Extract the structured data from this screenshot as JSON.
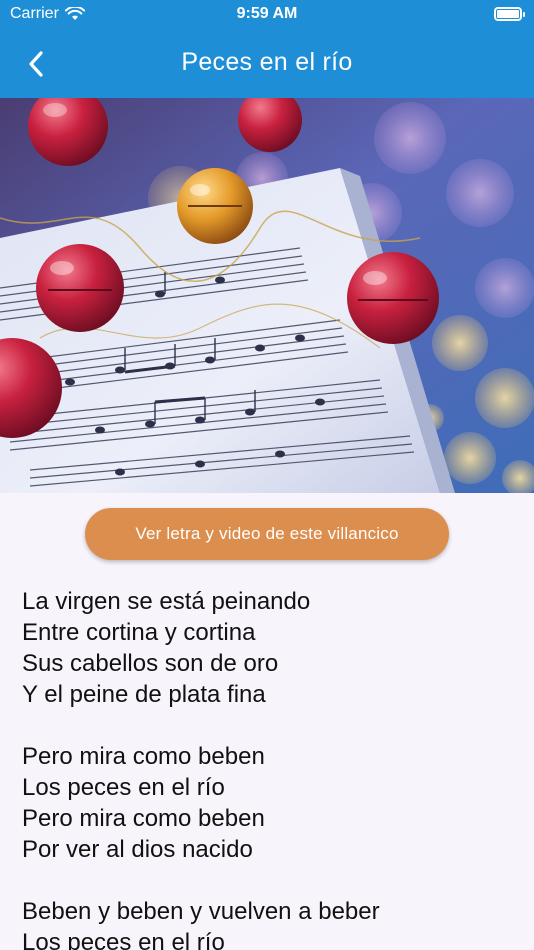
{
  "status_bar": {
    "carrier": "Carrier",
    "time": "9:59 AM",
    "wifi_icon": "wifi-icon",
    "battery_icon": "battery-icon"
  },
  "navbar": {
    "title": "Peces en el río",
    "back_icon": "chevron-left-icon",
    "background_color": "#1e8fd6"
  },
  "hero": {
    "description_icon": "christmas-bells-sheet-music-image"
  },
  "action_button": {
    "label": "Ver letra y video de este villancico",
    "color": "#dc8e4e"
  },
  "lyrics": {
    "stanzas": [
      [
        "La virgen se está peinando",
        "Entre cortina y cortina",
        "Sus cabellos son de oro",
        "Y el peine de plata fina"
      ],
      [
        "Pero mira como beben",
        "Los peces en el río",
        "Pero mira como beben",
        "Por ver al dios nacido"
      ],
      [
        "Beben y beben y vuelven a beber",
        "Los peces en el río"
      ]
    ]
  }
}
